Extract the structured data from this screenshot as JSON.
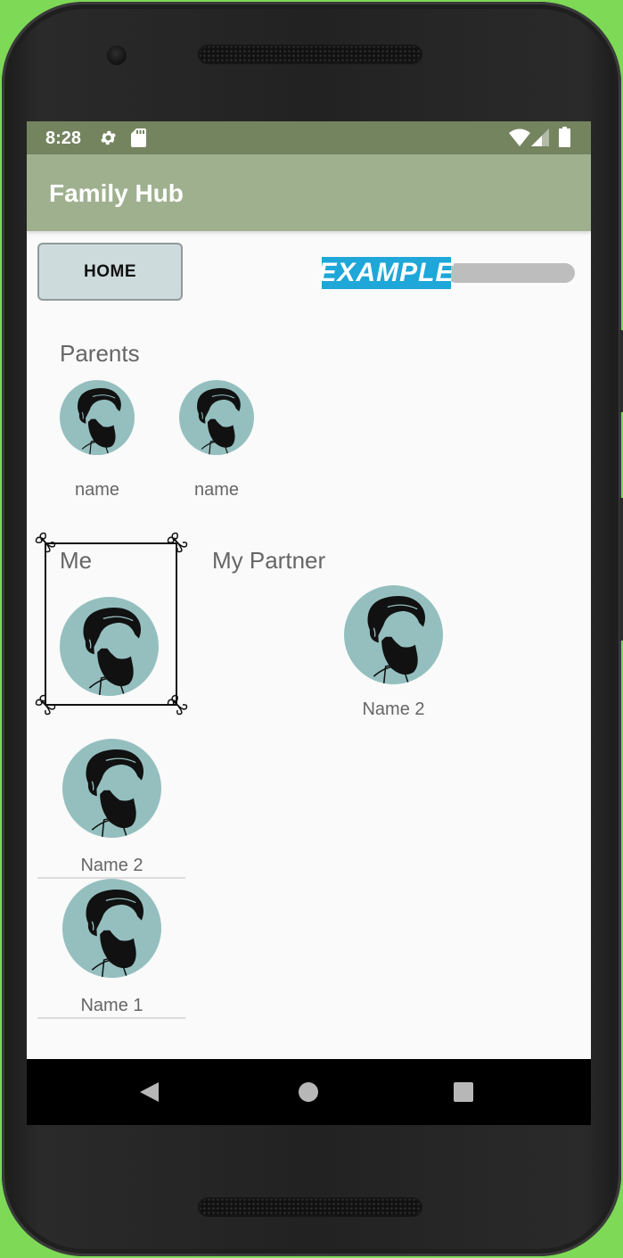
{
  "status": {
    "time": "8:28"
  },
  "app": {
    "title": "Family Hub"
  },
  "toolbar": {
    "home_label": "HOME",
    "example_label": "EXAMPLE"
  },
  "sections": {
    "parents_label": "Parents",
    "me_label": "Me",
    "partner_label": "My Partner"
  },
  "parents": [
    {
      "name": "name"
    },
    {
      "name": "name"
    }
  ],
  "partner": {
    "name": "Name 2"
  },
  "children": [
    {
      "name": "Name 2"
    },
    {
      "name": "Name 1"
    }
  ],
  "colors": {
    "background": "#7ed957",
    "status_bar": "#74845f",
    "app_bar": "#9fb08f",
    "avatar_bg": "#95bfbf",
    "home_button": "#cddbdc",
    "example_badge": "#1ea7d8"
  },
  "icons": {
    "status_left": [
      "gear-icon",
      "sd-card-icon"
    ],
    "status_right": [
      "wifi-icon",
      "signal-icon",
      "battery-icon"
    ],
    "avatar": "bearded-man-icon",
    "nav": [
      "back-icon",
      "home-icon",
      "recents-icon"
    ]
  }
}
